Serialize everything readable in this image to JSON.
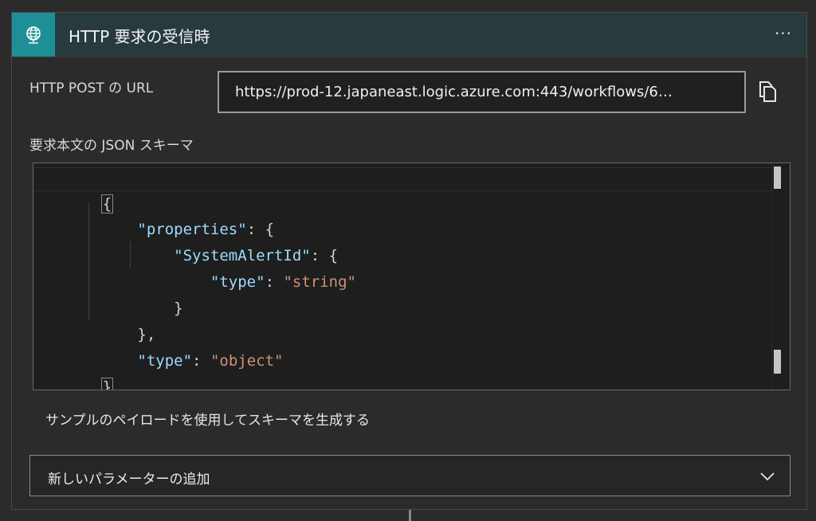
{
  "header": {
    "title": "HTTP 要求の受信時",
    "more_label": "···",
    "icon": "globe-network-icon",
    "accent_color": "#1f8f97"
  },
  "url_field": {
    "label": "HTTP POST の URL",
    "value": "https://prod-12.japaneast.logic.azure.com:443/workflows/6…",
    "copy_icon": "copy-icon"
  },
  "schema": {
    "label": "要求本文の JSON スキーマ",
    "code_lines": [
      [
        "{"
      ],
      [
        "\"properties\"",
        ": {"
      ],
      [
        "\"SystemAlertId\"",
        ": {"
      ],
      [
        "\"type\"",
        ": ",
        "\"string\""
      ],
      [
        "}"
      ],
      [
        "},"
      ],
      [
        "\"type\"",
        ": ",
        "\"object\""
      ],
      [
        "}"
      ]
    ]
  },
  "generate_link": "サンプルのペイロードを使用してスキーマを生成する",
  "add_parameter": {
    "label": "新しいパラメーターの追加",
    "icon": "chevron-down-icon"
  }
}
